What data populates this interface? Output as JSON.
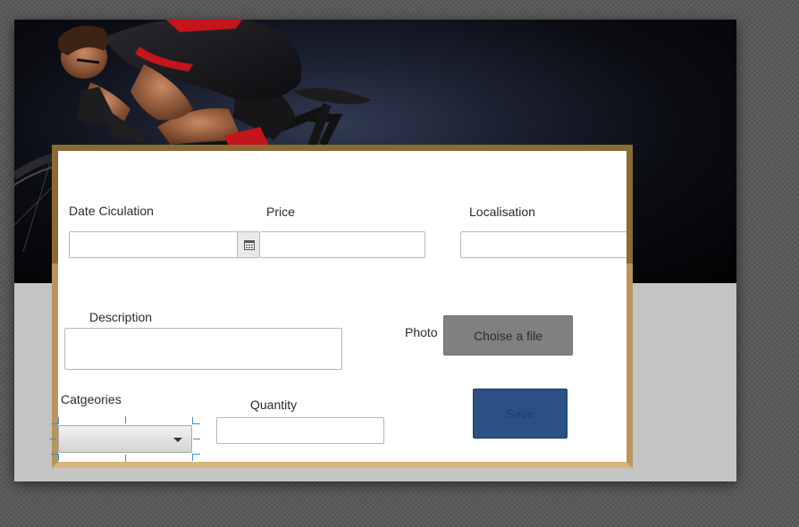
{
  "form": {
    "date_label": "Date Ciculation",
    "price_label": "Price",
    "localisation_label": "Localisation",
    "description_label": "Description",
    "photo_label": "Photo",
    "file_button_label": "Choise a file",
    "categories_label": "Catgeories",
    "quantity_label": "Quantity",
    "save_label": "Save"
  },
  "icons": {
    "date_picker": "calendar-icon",
    "combo_arrow": "chevron-down-icon"
  },
  "colors": {
    "frame_border": "#d8b77a",
    "save_button": "#2b5184",
    "file_button": "#808080",
    "selection_handles": "#3d8fd6"
  }
}
